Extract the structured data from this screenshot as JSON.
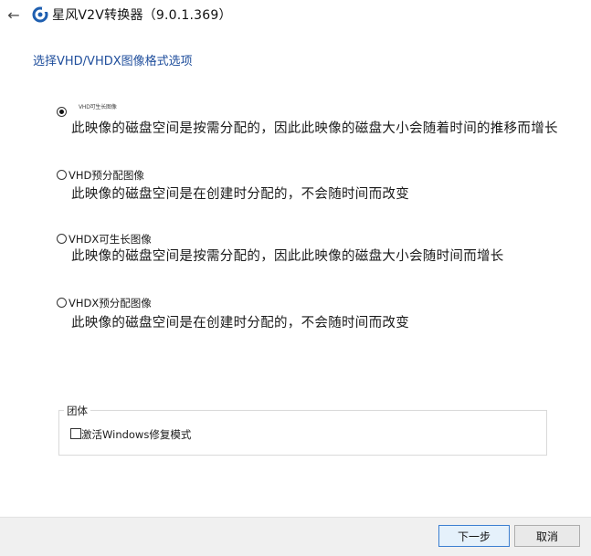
{
  "window": {
    "title": "星风V2V转换器（9.0.1.369）",
    "back_icon": "arrow-left-icon",
    "logo_icon": "app-logo-icon",
    "accent_color": "#1f4e9c"
  },
  "page": {
    "section_title": "选择VHD/VHDX图像格式选项"
  },
  "options": [
    {
      "label": "VHD可生长图像",
      "description": "此映像的磁盘空间是按需分配的，因此此映像的磁盘大小会随着时间的推移而增长",
      "selected": true
    },
    {
      "label": "VHD预分配图像",
      "description": "此映像的磁盘空间是在创建时分配的，不会随时间而改变",
      "selected": false
    },
    {
      "label": "VHDX可生长图像",
      "description": "此映像的磁盘空间是按需分配的，因此此映像的磁盘大小会随时间而增长",
      "selected": false
    },
    {
      "label": "VHDX预分配图像",
      "description": "此映像的磁盘空间是在创建时分配的，不会随时间而改变",
      "selected": false
    }
  ],
  "group": {
    "label": "团体",
    "checkbox_label": "激活Windows修复模式",
    "checked": false
  },
  "footer": {
    "next_label": "下一步",
    "cancel_label": "取消"
  }
}
